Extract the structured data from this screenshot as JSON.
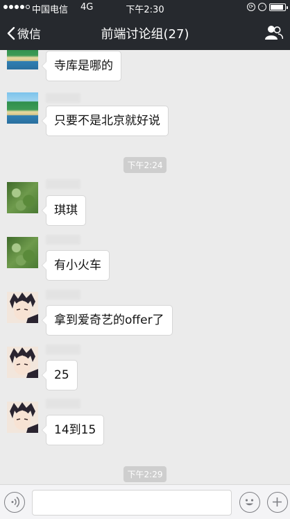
{
  "status_bar": {
    "carrier": "中国电信",
    "network": "4G",
    "time": "下午2:30",
    "battery_level": 0.9
  },
  "nav": {
    "back_label": "微信",
    "title": "前端讨论组(27)",
    "right_icon": "group-members-icon"
  },
  "messages": [
    {
      "avatar": "beach",
      "text": "寺库是哪的"
    },
    {
      "avatar": "beach",
      "text": "只要不是北京就好说"
    },
    {
      "timestamp": "下午2:24"
    },
    {
      "avatar": "plant",
      "text": "琪琪"
    },
    {
      "avatar": "plant",
      "text": "有小火车"
    },
    {
      "avatar": "anime",
      "text": "拿到爱奇艺的offer了"
    },
    {
      "avatar": "anime",
      "text": "25"
    },
    {
      "avatar": "anime",
      "text": "14到15"
    },
    {
      "timestamp": "下午2:29"
    }
  ],
  "input_bar": {
    "voice_icon": "voice-icon",
    "emoji_icon": "emoji-icon",
    "more_icon": "plus-icon"
  },
  "colors": {
    "nav_background": "#26292e",
    "chat_background": "#ebebeb",
    "bubble_background": "#ffffff",
    "timestamp_background": "#cecece"
  }
}
